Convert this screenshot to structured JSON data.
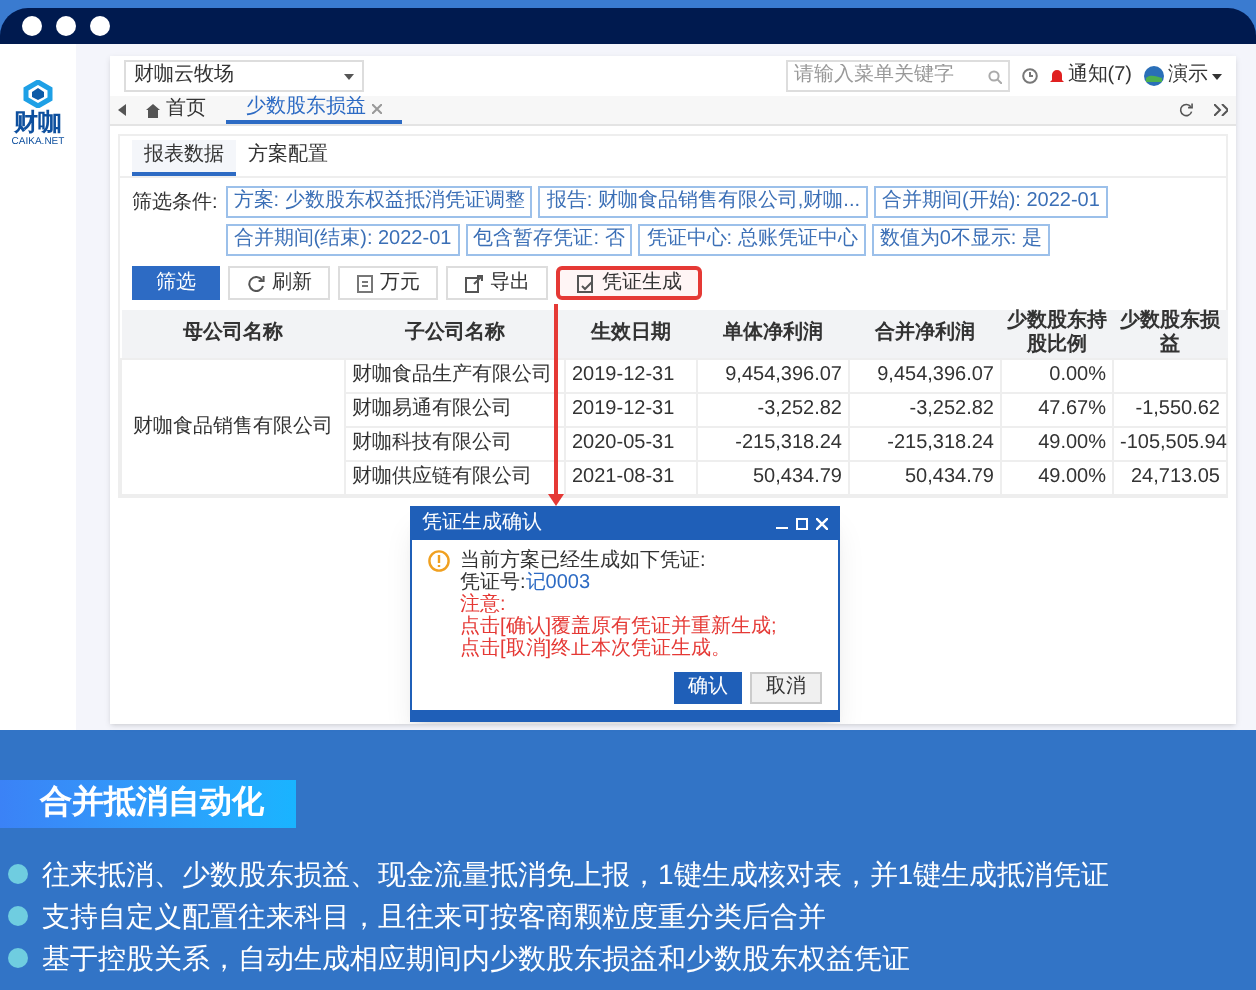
{
  "logo": {
    "name": "财咖",
    "domain": "CAIKA.NET"
  },
  "app": {
    "company_select": "财咖云牧场",
    "search": {
      "placeholder": "请输入菜单关键字"
    },
    "notifications": "通知(7)",
    "user": "演示",
    "tabs": [
      {
        "label": "首页",
        "selected": false,
        "closable": false
      },
      {
        "label": "少数股东损益",
        "selected": true,
        "closable": true
      }
    ],
    "subtabs": [
      {
        "label": "报表数据",
        "selected": true
      },
      {
        "label": "方案配置",
        "selected": false
      }
    ],
    "filter_label": "筛选条件:",
    "filters": [
      "方案: 少数股东权益抵消凭证调整",
      "报告: 财咖食品销售有限公司,财咖...",
      "合并期间(开始): 2022-01",
      "合并期间(结束): 2022-01",
      "包含暂存凭证: 否",
      "凭证中心: 总账凭证中心",
      "数值为0不显示: 是"
    ],
    "buttons": [
      {
        "label": "筛选",
        "kind": "primary",
        "highlighted": false
      },
      {
        "label": "刷新",
        "kind": "refresh",
        "highlighted": false
      },
      {
        "label": "万元",
        "kind": "unit",
        "highlighted": false
      },
      {
        "label": "导出",
        "kind": "export",
        "highlighted": false
      },
      {
        "label": "凭证生成",
        "kind": "voucher",
        "highlighted": true
      }
    ],
    "table": {
      "columns": [
        "母公司名称",
        "子公司名称",
        "生效日期",
        "单体净利润",
        "合并净利润",
        "少数股东持股比例",
        "少数股东损益"
      ],
      "rows": [
        [
          {
            "text": "财咖食品销售有限公司",
            "rowspan": 4
          },
          "财咖食品生产有限公司",
          "2019-12-31",
          "9,454,396.07",
          "9,454,396.07",
          "0.00%"
        ],
        [
          "财咖易通有限公司",
          "2019-12-31",
          "-3,252.82",
          "-3,252.82",
          "47.67%",
          "-1,550.62"
        ],
        [
          "财咖科技有限公司",
          "2020-05-31",
          "-215,318.24",
          "-215,318.24",
          "49.00%",
          "-105,505.94"
        ],
        [
          "财咖供应链有限公司",
          "2021-08-31",
          "50,434.79",
          "50,434.79",
          "49.00%",
          "24,713.05"
        ]
      ]
    },
    "dialog": {
      "title": "凭证生成确认",
      "message": "当前方案已经生成如下凭证:",
      "voucher_label": "凭证号:",
      "voucher_no": "记0003",
      "notes": [
        "注意:",
        "点击[确认]覆盖原有凭证并重新生成;",
        "点击[取消]终止本次凭证生成。"
      ],
      "buttons": [
        {
          "label": "确认",
          "kind": "primary"
        },
        {
          "label": "取消",
          "kind": "secondary"
        }
      ]
    }
  },
  "feature": {
    "title": "合并抵消自动化",
    "bullets": [
      "往来抵消、少数股东损益、现金流量抵消免上报，1键生成核对表，并1键生成抵消凭证",
      "支持自定义配置往来科目，且往来可按客商颗粒度重分类后合并",
      "基于控股关系，自动生成相应期间内少数股东损益和少数股东权益凭证"
    ]
  }
}
